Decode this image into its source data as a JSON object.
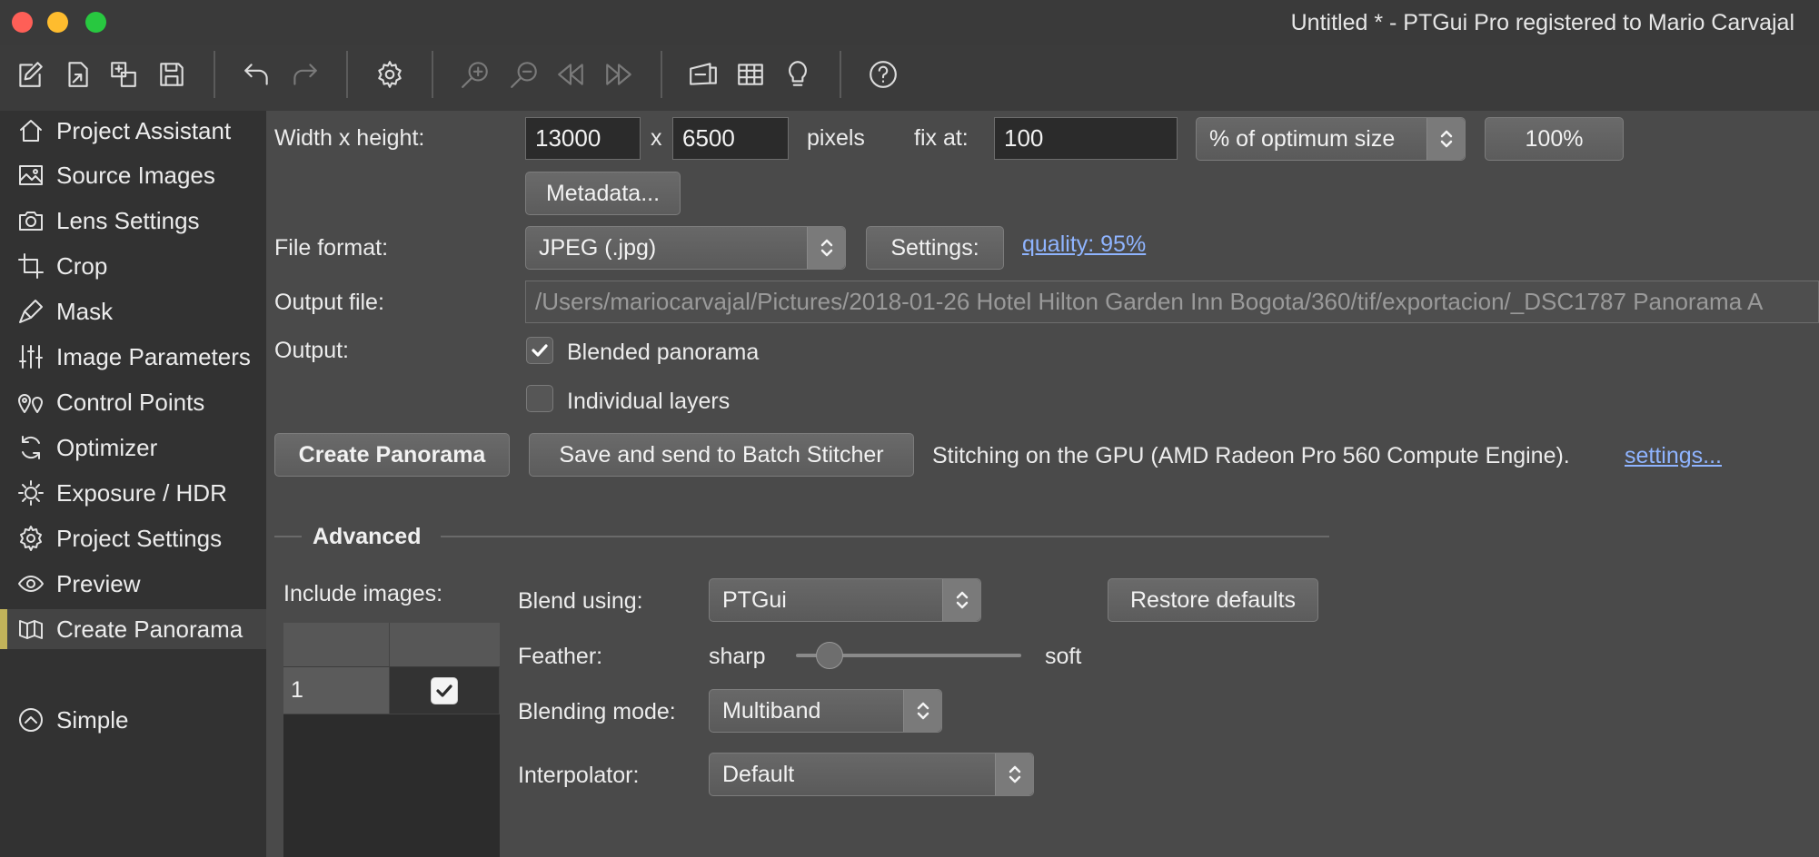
{
  "window": {
    "title": "Untitled * - PTGui Pro registered to Mario Carvajal"
  },
  "toolbar": {
    "icons": [
      "new-project-icon",
      "open-project-icon",
      "load-images-icon",
      "save-icon",
      "undo-icon",
      "redo-icon",
      "preferences-gear-icon",
      "zoom-in-icon",
      "zoom-out-icon",
      "previous-icon",
      "next-icon",
      "panorama-editor-icon",
      "table-icon",
      "tips-lightbulb-icon",
      "help-icon"
    ]
  },
  "sidebar": {
    "items": [
      {
        "label": "Project Assistant",
        "icon": "home-icon"
      },
      {
        "label": "Source Images",
        "icon": "image-icon"
      },
      {
        "label": "Lens Settings",
        "icon": "camera-icon"
      },
      {
        "label": "Crop",
        "icon": "crop-icon"
      },
      {
        "label": "Mask",
        "icon": "mask-pen-icon"
      },
      {
        "label": "Image Parameters",
        "icon": "sliders-icon"
      },
      {
        "label": "Control Points",
        "icon": "control-points-icon"
      },
      {
        "label": "Optimizer",
        "icon": "optimizer-icon"
      },
      {
        "label": "Exposure / HDR",
        "icon": "sun-icon"
      },
      {
        "label": "Project Settings",
        "icon": "gear-icon"
      },
      {
        "label": "Preview",
        "icon": "eye-icon"
      },
      {
        "label": "Create Panorama",
        "icon": "panorama-icon"
      }
    ],
    "active_index": 11,
    "simple_label": "Simple"
  },
  "main": {
    "size_label": "Width x height:",
    "width_value": "13000",
    "x_label": "x",
    "height_value": "6500",
    "pixels_label": "pixels",
    "fix_at_label": "fix at:",
    "fix_at_value": "100",
    "size_mode": "% of optimum size",
    "percent_button": "100%",
    "metadata_button": "Metadata...",
    "file_format_label": "File format:",
    "file_format_value": "JPEG (.jpg)",
    "settings_button": "Settings:",
    "quality_link": "quality: 95%",
    "output_file_label": "Output file:",
    "output_file_value": "/Users/mariocarvajal/Pictures/2018-01-26 Hotel Hilton Garden Inn Bogota/360/tif/exportacion/_DSC1787 Panorama A",
    "output_label": "Output:",
    "blended_label": "Blended panorama",
    "blended_checked": true,
    "individual_label": "Individual layers",
    "individual_checked": false,
    "create_button": "Create Panorama",
    "batch_button": "Save and send to Batch Stitcher",
    "gpu_text": "Stitching on the GPU (AMD Radeon Pro 560 Compute Engine).",
    "gpu_settings_link": "settings..."
  },
  "advanced": {
    "title": "Advanced",
    "include_images_label": "Include images:",
    "rows": [
      {
        "index": "1",
        "included": true
      }
    ],
    "blend_using_label": "Blend using:",
    "blend_using_value": "PTGui",
    "restore_button": "Restore defaults",
    "feather_label": "Feather:",
    "feather_min": "sharp",
    "feather_max": "soft",
    "feather_level": 0.15,
    "blending_mode_label": "Blending mode:",
    "blending_mode_value": "Multiband",
    "interpolator_label": "Interpolator:",
    "interpolator_value": "Default"
  },
  "colors": {
    "accent_bar": "#c2b35a",
    "link": "#8fb4ff",
    "close": "#fe5f57",
    "minimize": "#febc2e",
    "maximize": "#28c840"
  }
}
